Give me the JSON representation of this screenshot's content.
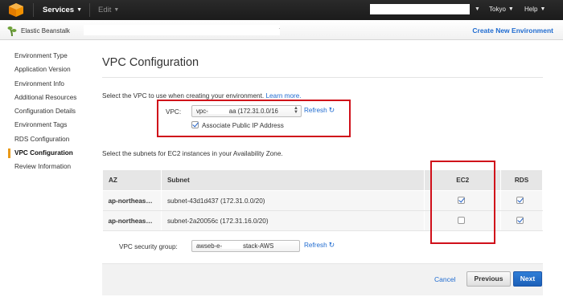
{
  "colors": {
    "accent_link": "#1f6bd0",
    "highlight_box": "#d0101a",
    "nav_bg": "#1b1b1b",
    "active_marker": "#e99a19"
  },
  "topnav": {
    "logo_icon": "aws-cube-icon",
    "services_label": "Services",
    "edit_label": "Edit",
    "region_label": "Tokyo",
    "help_label": "Help"
  },
  "subnav": {
    "service_icon": "elastic-beanstalk-icon",
    "service_label": "Elastic Beanstalk",
    "create_env_label": "Create New Environment"
  },
  "sidebar": {
    "items": [
      {
        "label": "Environment Type",
        "active": false
      },
      {
        "label": "Application Version",
        "active": false
      },
      {
        "label": "Environment Info",
        "active": false
      },
      {
        "label": "Additional Resources",
        "active": false
      },
      {
        "label": "Configuration Details",
        "active": false
      },
      {
        "label": "Environment Tags",
        "active": false
      },
      {
        "label": "RDS Configuration",
        "active": false
      },
      {
        "label": "VPC Configuration",
        "active": true
      },
      {
        "label": "Review Information",
        "active": false
      }
    ]
  },
  "main": {
    "title": "VPC Configuration",
    "intro_text": "Select the VPC to use when creating your environment.",
    "learn_more": "Learn more.",
    "vpc_label": "VPC:",
    "vpc_value_prefix": "vpc-",
    "vpc_value_suffix": "aa (172.31.0.0/16",
    "refresh_label": "Refresh",
    "associate_label": "Associate Public IP Address",
    "associate_checked": true,
    "subnets_intro": "Select the subnets for EC2 instances in your Availability Zone.",
    "table": {
      "headers": {
        "az": "AZ",
        "subnet": "Subnet",
        "ec2": "EC2",
        "rds": "RDS"
      },
      "rows": [
        {
          "az": "ap-northeas…",
          "subnet": "subnet-43d1d437 (172.31.0.0/20)",
          "ec2": true,
          "rds": true
        },
        {
          "az": "ap-northeas…",
          "subnet": "subnet-2a20056c (172.31.16.0/20)",
          "ec2": false,
          "rds": true
        }
      ]
    },
    "sg_label": "VPC security group:",
    "sg_value_prefix": "awseb-e-",
    "sg_value_suffix": "stack-AWS",
    "cancel_label": "Cancel",
    "previous_label": "Previous",
    "next_label": "Next"
  }
}
